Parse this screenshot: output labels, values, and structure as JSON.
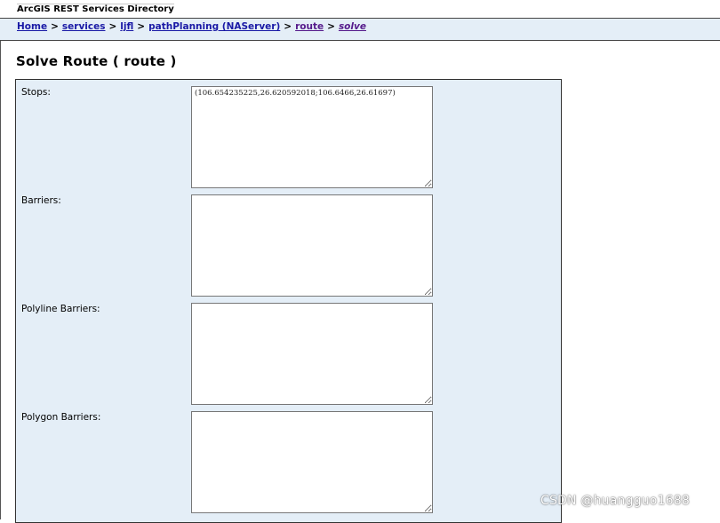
{
  "header": {
    "title": "ArcGIS REST Services Directory"
  },
  "breadcrumb": {
    "items": [
      "Home",
      "services",
      "ljfl",
      "pathPlanning (NAServer)",
      "route",
      "solve"
    ],
    "separator": ">"
  },
  "page": {
    "title": "Solve Route ( route )"
  },
  "form": {
    "stops": {
      "label": "Stops:",
      "value": "(106.654235225,26.620592018;106.6466,26.61697)"
    },
    "barriers": {
      "label": "Barriers:",
      "value": ""
    },
    "polyline_barriers": {
      "label": "Polyline Barriers:",
      "value": ""
    },
    "polygon_barriers": {
      "label": "Polygon Barriers:",
      "value": ""
    }
  },
  "watermark": {
    "text": "CSDN @huangguo1688"
  },
  "colors": {
    "panel_bg": "#e4eef7",
    "link": "#1a1aa6",
    "visited_link": "#551a8b"
  }
}
